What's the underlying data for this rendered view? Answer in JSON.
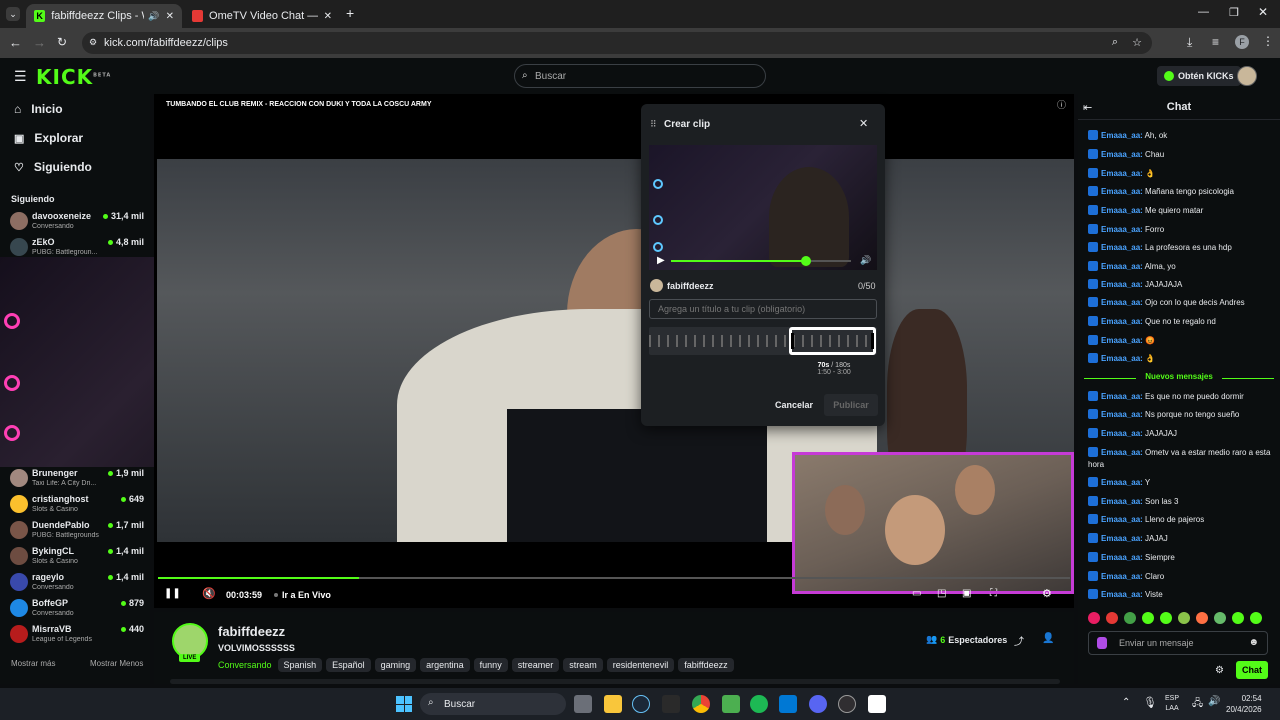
{
  "browser": {
    "tabs": [
      {
        "label": "fabiffdeezz Clips - Watch Li"
      },
      {
        "label": "OmeTV Video Chat — Omegle"
      }
    ],
    "url": "kick.com/fabiffdeezz/clips"
  },
  "kick": {
    "logo": "KICK",
    "logo_sup": "BETA",
    "search_placeholder": "Buscar",
    "get_kicks": "Obtén KICKs"
  },
  "sidebar": {
    "nav": [
      {
        "label": "Inicio",
        "icon": "home-icon"
      },
      {
        "label": "Explorar",
        "icon": "explore-icon"
      },
      {
        "label": "Siguiendo",
        "icon": "heart-icon"
      }
    ],
    "following_header": "Siguiendo",
    "following": [
      {
        "name": "davooxeneize",
        "game": "Conversando",
        "viewers": "31,4 mil",
        "color": "#8d6e63"
      },
      {
        "name": "zEkO",
        "game": "PUBG: Battlegroun...",
        "viewers": "4,8 mil",
        "color": "#37474f"
      },
      {
        "name": "Brunenger",
        "game": "Taxi Life: A City Dri...",
        "viewers": "1,9 mil",
        "color": "#a1887f"
      },
      {
        "name": "cristianghost",
        "game": "Slots & Casino",
        "viewers": "649",
        "color": "#fbc02d"
      },
      {
        "name": "DuendePablo",
        "game": "PUBG: Battlegrounds",
        "viewers": "1,7 mil",
        "color": "#795548"
      },
      {
        "name": "BykingCL",
        "game": "Slots & Casino",
        "viewers": "1,4 mil",
        "color": "#6d4c41"
      },
      {
        "name": "rageylo",
        "game": "Conversando",
        "viewers": "1,4 mil",
        "color": "#3949ab"
      },
      {
        "name": "BoffeGP",
        "game": "Conversando",
        "viewers": "879",
        "color": "#1e88e5"
      },
      {
        "name": "MisrraVB",
        "game": "League of Legends",
        "viewers": "440",
        "color": "#b71c1c"
      }
    ],
    "show_more": "Mostrar más",
    "show_less": "Mostrar Menos"
  },
  "player": {
    "title": "TUMBANDO EL CLUB REMIX - REACCION CON DUKI Y TODA LA COSCU ARMY",
    "time": "00:03:59",
    "go_live": "Ir a En Vivo",
    "progress": 0.22
  },
  "clip_modal": {
    "title": "Crear clip",
    "channel": "fabiffdeezz",
    "char_count": "0/50",
    "title_placeholder": "Agrega un título a tu clip (obligatorio)",
    "duration": "70s",
    "max_duration": "/ 180s",
    "range": "1:50 - 3:00",
    "cancel": "Cancelar",
    "publish": "Publicar",
    "volume": 0.75
  },
  "channel": {
    "name": "fabiffdeezz",
    "live_badge": "LIVE",
    "stream_title": "VOLVIMOSSSSSS",
    "category": "Conversando",
    "tags": [
      "Spanish",
      "Español",
      "gaming",
      "argentina",
      "funny",
      "streamer",
      "stream",
      "residentenevil",
      "fabiffdeezz"
    ],
    "viewers": "6",
    "viewers_label": "Espectadores"
  },
  "chat": {
    "header": "Chat",
    "messages_before": [
      {
        "user": "Emaaa_aa:",
        "text": "Ah, ok"
      },
      {
        "user": "Emaaa_aa:",
        "text": "Chau"
      },
      {
        "user": "Emaaa_aa:",
        "text": "👌"
      },
      {
        "user": "Emaaa_aa:",
        "text": "Mañana tengo psicologia"
      },
      {
        "user": "Emaaa_aa:",
        "text": "Me quiero matar"
      },
      {
        "user": "Emaaa_aa:",
        "text": "Forro"
      },
      {
        "user": "Emaaa_aa:",
        "text": "La profesora es una hdp"
      },
      {
        "user": "Emaaa_aa:",
        "text": "Alma, yo"
      },
      {
        "user": "Emaaa_aa:",
        "text": "JAJAJAJA"
      },
      {
        "user": "Emaaa_aa:",
        "text": "Ojo con lo que decis Andres"
      },
      {
        "user": "Emaaa_aa:",
        "text": "Que no te regalo nd"
      },
      {
        "user": "Emaaa_aa:",
        "text": "😡"
      },
      {
        "user": "Emaaa_aa:",
        "text": "👌"
      }
    ],
    "new_messages": "Nuevos mensajes",
    "messages_after": [
      {
        "user": "Emaaa_aa:",
        "text": "Es que no me puedo dormir"
      },
      {
        "user": "Emaaa_aa:",
        "text": "Ns porque no tengo sueño"
      },
      {
        "user": "Emaaa_aa:",
        "text": "JAJAJAJ"
      },
      {
        "user": "Emaaa_aa:",
        "text": "Ometv va a estar medio raro a esta hora"
      },
      {
        "user": "Emaaa_aa:",
        "text": "Y"
      },
      {
        "user": "Emaaa_aa:",
        "text": "Son las 3"
      },
      {
        "user": "Emaaa_aa:",
        "text": "Lleno de pajeros"
      },
      {
        "user": "Emaaa_aa:",
        "text": "JAJAJ"
      },
      {
        "user": "Emaaa_aa:",
        "text": "Siempre"
      },
      {
        "user": "Emaaa_aa:",
        "text": "Claro"
      },
      {
        "user": "Emaaa_aa:",
        "text": "Viste"
      }
    ],
    "input_placeholder": "Enviar un mensaje",
    "send": "Chat"
  },
  "taskbar": {
    "search": "Buscar",
    "lang_top": "ESP",
    "lang_bottom": "LAA",
    "time": "02:54",
    "date": "20/4/2026"
  },
  "colors": {
    "accent": "#53fc18",
    "chat_user": "#4aa3ff",
    "pip_border": "#c63bd6"
  }
}
